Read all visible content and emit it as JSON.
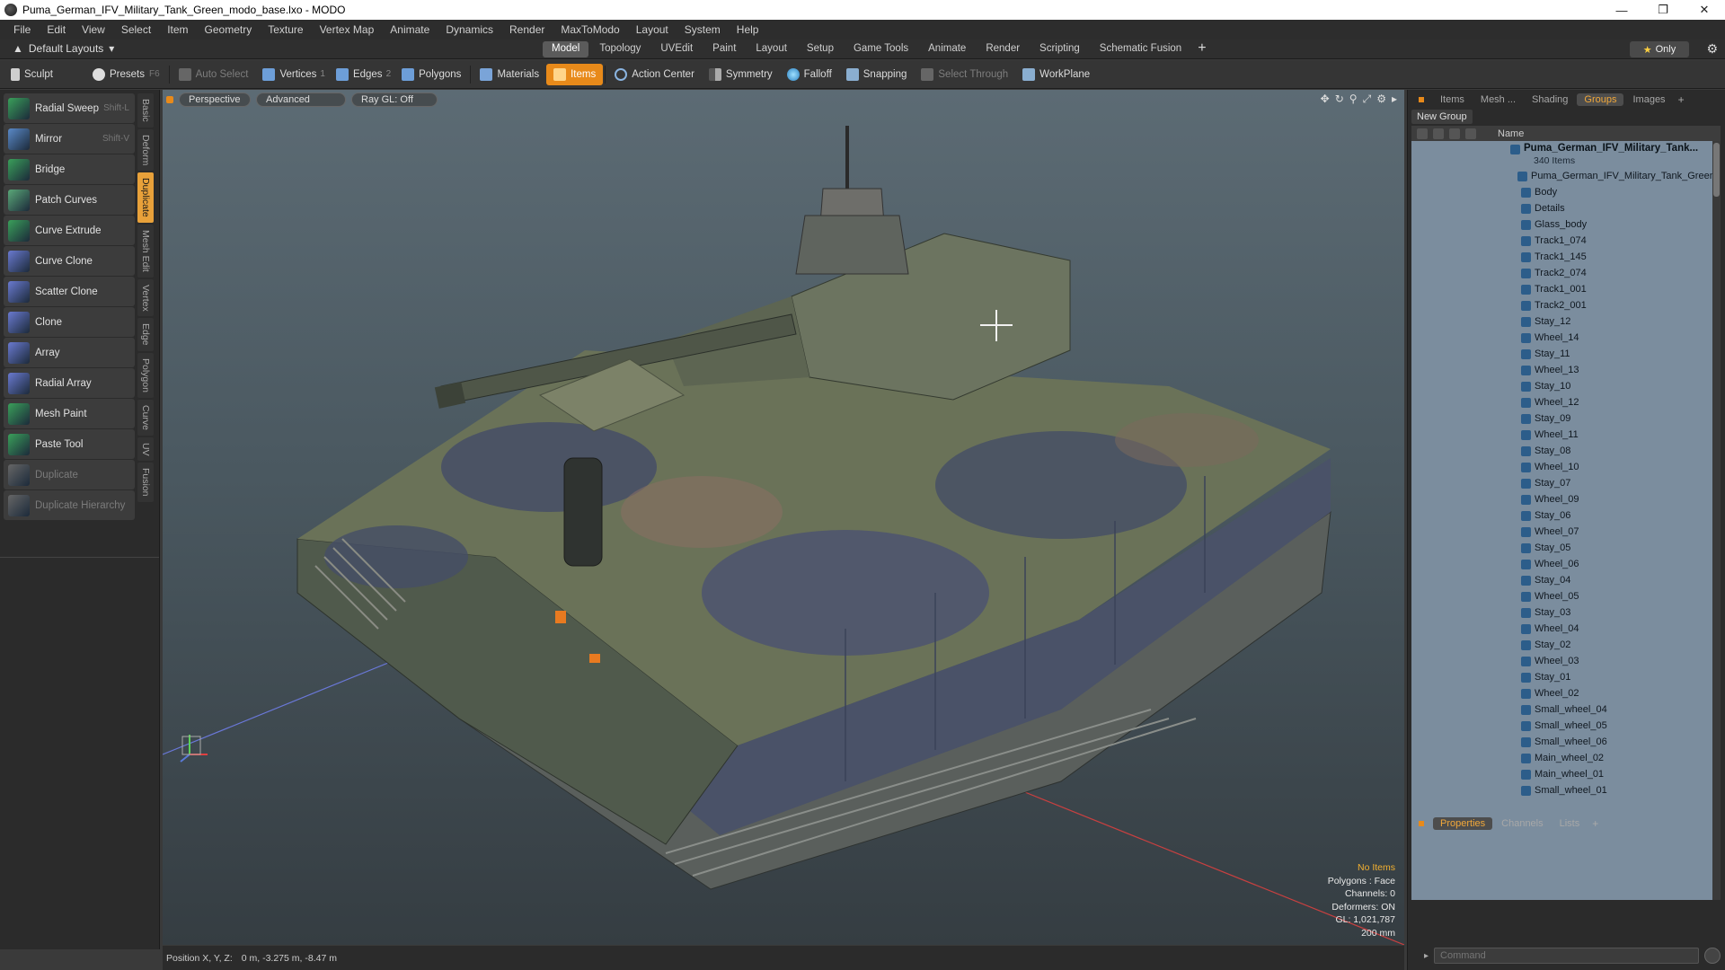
{
  "window": {
    "title": "Puma_German_IFV_Military_Tank_Green_modo_base.lxo - MODO"
  },
  "menu": [
    "File",
    "Edit",
    "View",
    "Select",
    "Item",
    "Geometry",
    "Texture",
    "Vertex Map",
    "Animate",
    "Dynamics",
    "Render",
    "MaxToModo",
    "Layout",
    "System",
    "Help"
  ],
  "layout_bar": {
    "layouts_label": "Default Layouts",
    "tabs": [
      "Model",
      "Topology",
      "UVEdit",
      "Paint",
      "Layout",
      "Setup",
      "Game Tools",
      "Animate",
      "Render",
      "Scripting",
      "Schematic Fusion"
    ],
    "active_tab": "Model",
    "only_label": "Only"
  },
  "toolbar": {
    "sculpt": "Sculpt",
    "presets": "Presets",
    "presets_key": "F6",
    "auto_select": "Auto Select",
    "vertices": "Vertices",
    "vertices_count": "1",
    "edges": "Edges",
    "edges_count": "2",
    "polygons": "Polygons",
    "materials": "Materials",
    "items": "Items",
    "action_center": "Action Center",
    "symmetry": "Symmetry",
    "falloff": "Falloff",
    "snapping": "Snapping",
    "select_through": "Select Through",
    "workplane": "WorkPlane"
  },
  "tools": [
    {
      "label": "Radial Sweep",
      "key": "Shift-L",
      "color": "#3aa05a"
    },
    {
      "label": "Mirror",
      "key": "Shift-V",
      "color": "#5a8ac8"
    },
    {
      "label": "Bridge",
      "key": "",
      "color": "#3aa05a"
    },
    {
      "label": "Patch Curves",
      "key": "",
      "color": "#5aa878"
    },
    {
      "label": "Curve Extrude",
      "key": "",
      "color": "#3aa05a"
    },
    {
      "label": "Curve Clone",
      "key": "",
      "color": "#6a7ad0"
    },
    {
      "label": "Scatter Clone",
      "key": "",
      "color": "#6a7ad0"
    },
    {
      "label": "Clone",
      "key": "",
      "color": "#6a7ad0"
    },
    {
      "label": "Array",
      "key": "",
      "color": "#6a7ad0"
    },
    {
      "label": "Radial Array",
      "key": "",
      "color": "#6a7ad0"
    },
    {
      "label": "Mesh Paint",
      "key": "",
      "color": "#3aa05a"
    },
    {
      "label": "Paste Tool",
      "key": "",
      "color": "#3aa05a"
    },
    {
      "label": "Duplicate",
      "key": "",
      "color": "#666666",
      "disabled": true
    },
    {
      "label": "Duplicate Hierarchy",
      "key": "",
      "color": "#666666",
      "disabled": true
    }
  ],
  "side_tabs": [
    "Basic",
    "Deform",
    "Duplicate",
    "Mesh Edit",
    "Vertex",
    "Edge",
    "Polygon",
    "Curve",
    "UV",
    "Fusion"
  ],
  "active_side_tab": "Duplicate",
  "viewport": {
    "view_mode": "Perspective",
    "shading": "Advanced",
    "ray_gl": "Ray GL: Off",
    "info": {
      "selection": "No Items",
      "polygons": "Polygons : Face",
      "channels": "Channels: 0",
      "deformers": "Deformers: ON",
      "gl": "GL: 1,021,787",
      "scale": "200 mm"
    }
  },
  "status": {
    "position_label": "Position X, Y, Z:",
    "position_value": "0 m, -3.275 m, -8.47 m"
  },
  "right_panel": {
    "tabs": [
      "Items",
      "Mesh ...",
      "Shading",
      "Groups",
      "Images"
    ],
    "active_tab": "Groups",
    "new_group": "New Group",
    "name_col": "Name",
    "root": {
      "name": "Puma_German_IFV_Military_Tank...",
      "count": "340 Items"
    },
    "items": [
      "Puma_German_IFV_Military_Tank_Green",
      "Body",
      "Details",
      "Glass_body",
      "Track1_074",
      "Track1_145",
      "Track2_074",
      "Track1_001",
      "Track2_001",
      "Stay_12",
      "Wheel_14",
      "Stay_11",
      "Wheel_13",
      "Stay_10",
      "Wheel_12",
      "Stay_09",
      "Wheel_11",
      "Stay_08",
      "Wheel_10",
      "Stay_07",
      "Wheel_09",
      "Stay_06",
      "Wheel_07",
      "Stay_05",
      "Wheel_06",
      "Stay_04",
      "Wheel_05",
      "Stay_03",
      "Wheel_04",
      "Stay_02",
      "Wheel_03",
      "Stay_01",
      "Wheel_02",
      "Small_wheel_04",
      "Small_wheel_05",
      "Small_wheel_06",
      "Main_wheel_02",
      "Main_wheel_01",
      "Small_wheel_01"
    ],
    "bottom_tabs": [
      "Properties",
      "Channels",
      "Lists"
    ],
    "active_bottom_tab": "Properties",
    "command_placeholder": "Command"
  }
}
